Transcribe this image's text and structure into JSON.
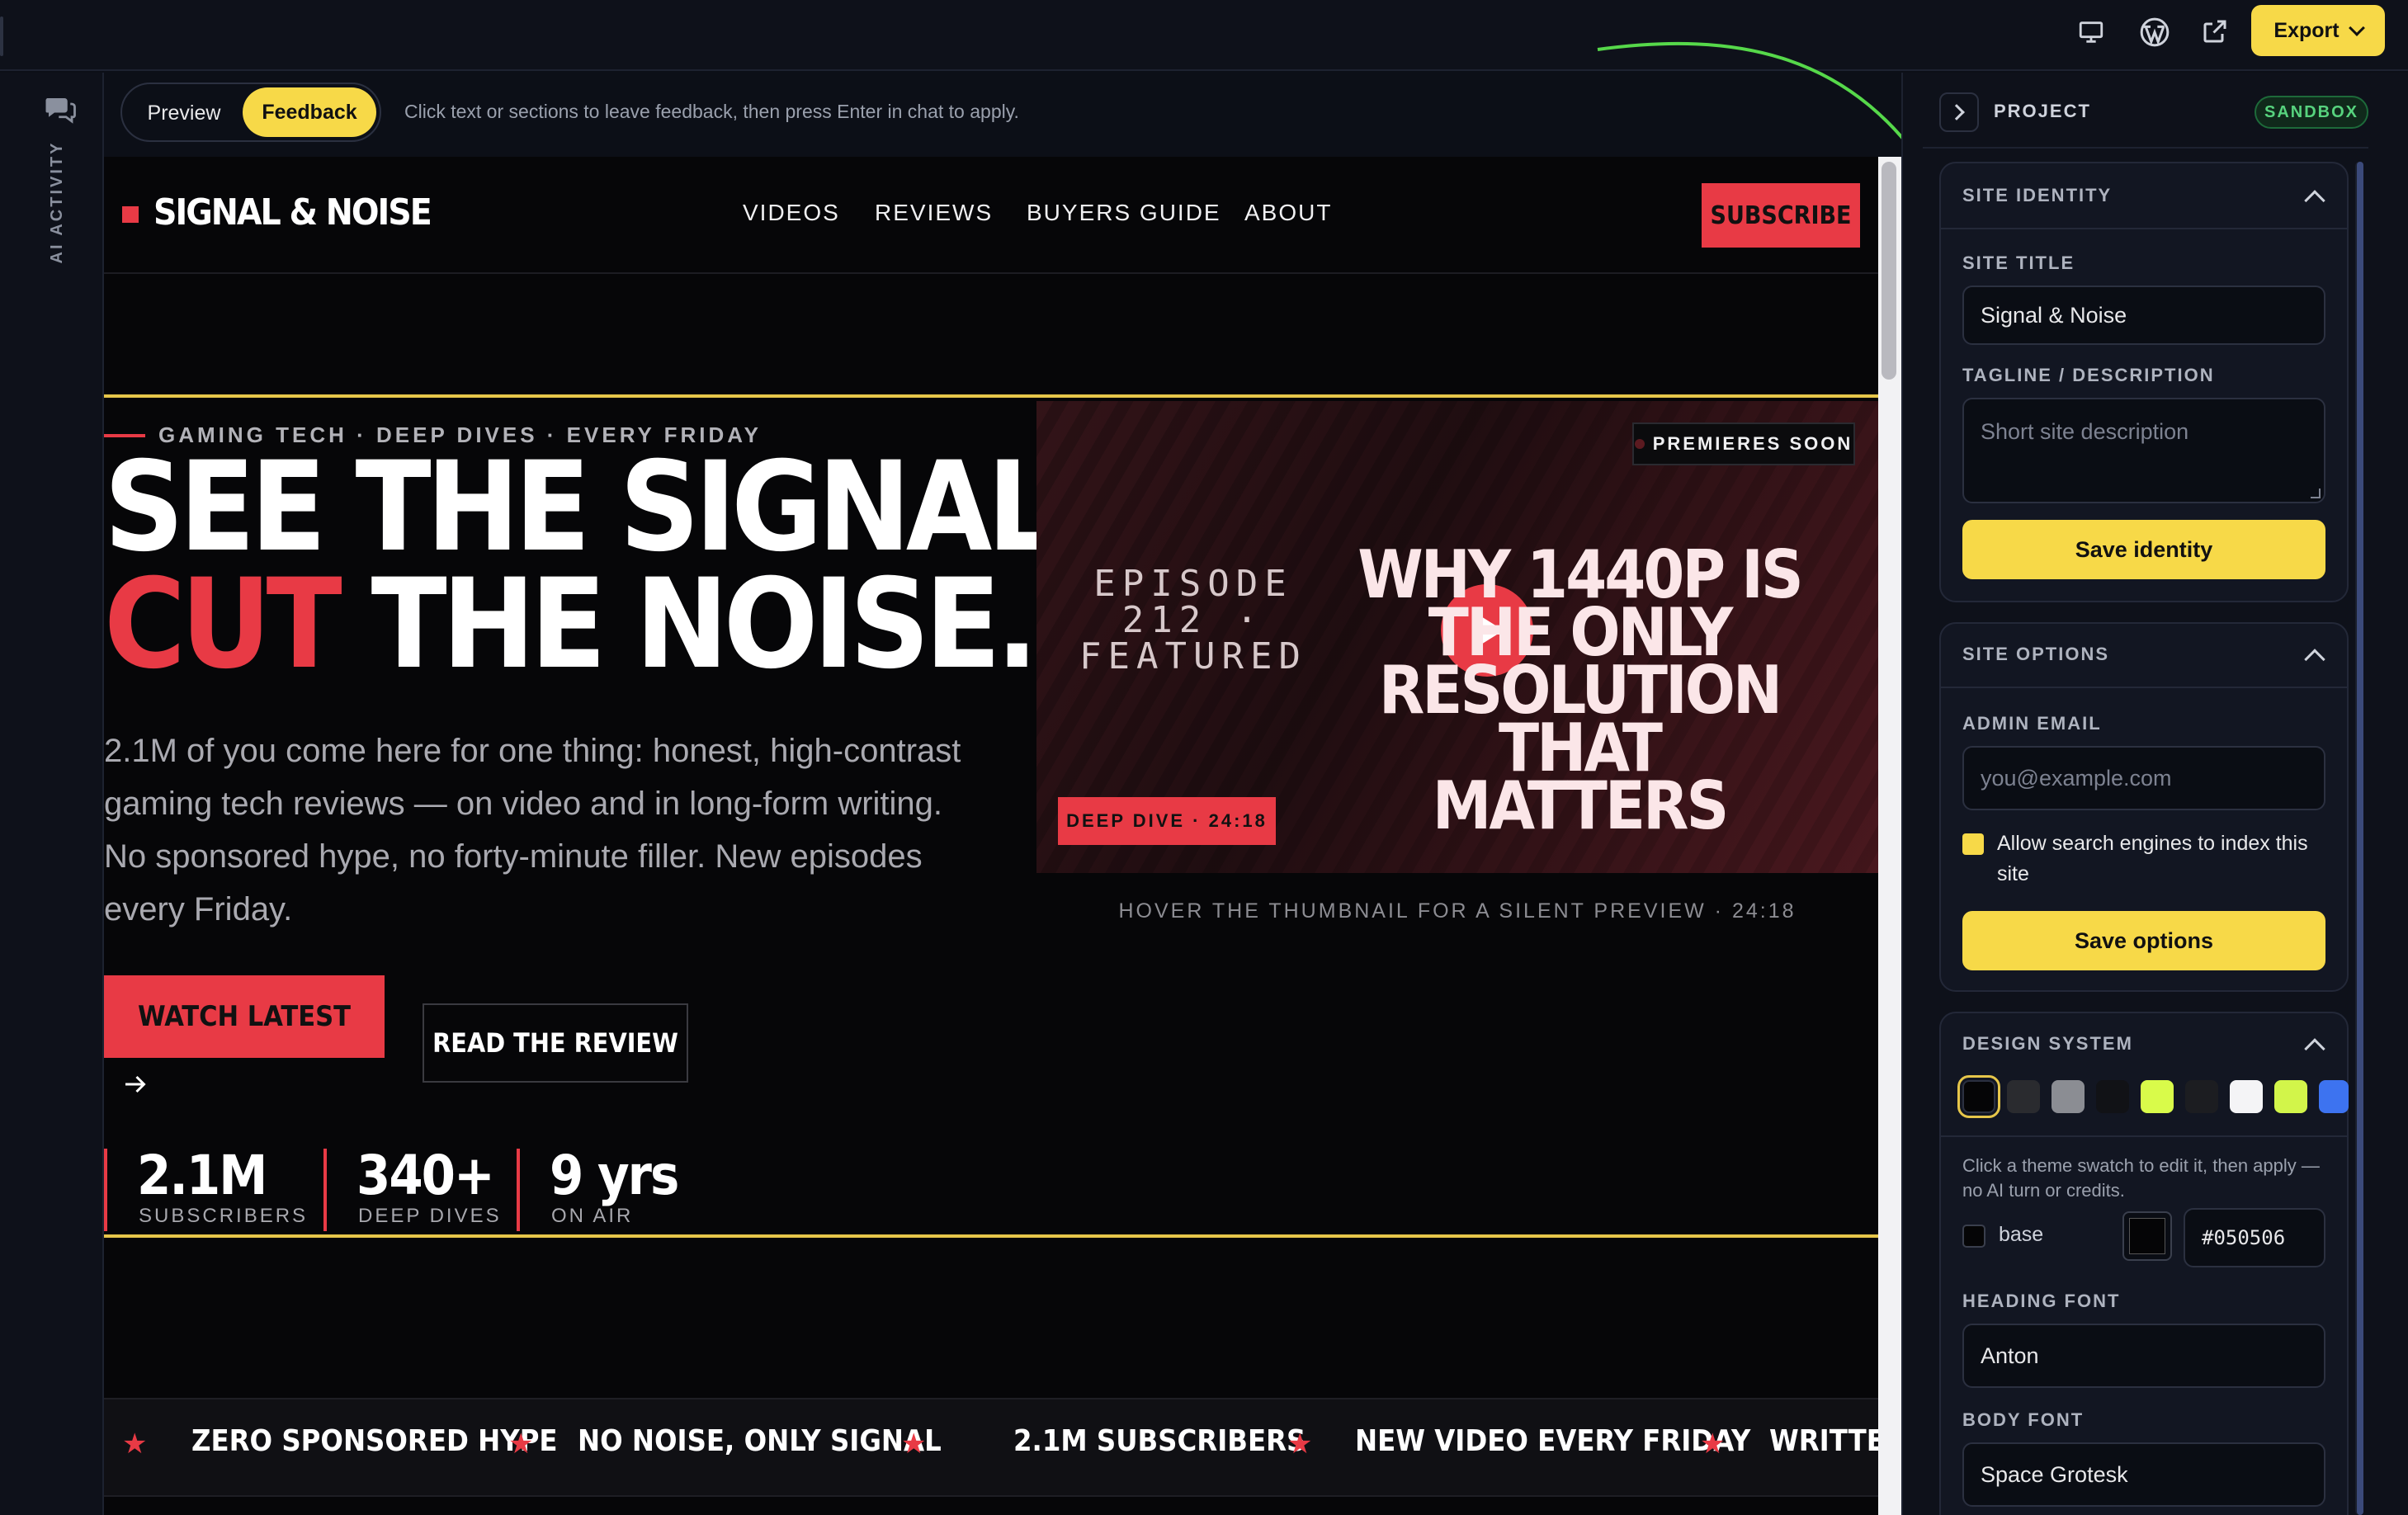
{
  "topbar": {
    "export_label": "Export"
  },
  "activity": {
    "label": "AI ACTIVITY"
  },
  "mode_toggle": {
    "preview": "Preview",
    "feedback": "Feedback",
    "hint": "Click text or sections to leave feedback, then press Enter in chat to apply."
  },
  "site": {
    "brand": "SIGNAL & NOISE",
    "nav": [
      "VIDEOS",
      "REVIEWS",
      "BUYERS GUIDE",
      "ABOUT"
    ],
    "subscribe": "SUBSCRIBE",
    "hero": {
      "eyebrow": "GAMING TECH · DEEP DIVES · EVERY FRIDAY",
      "line1": "SEE THE SIGNAL.",
      "line2_red": "CUT",
      "line2_rest": " THE NOISE.",
      "body": "2.1M of you come here for one thing: honest, high-contrast gaming tech reviews — on video and in long-form writing. No sponsored hype, no forty-minute filler. New episodes every Friday.",
      "cta_primary": "WATCH LATEST",
      "cta_secondary": "READ THE REVIEW"
    },
    "stats": [
      {
        "value": "2.1M",
        "label": "SUBSCRIBERS"
      },
      {
        "value": "340+",
        "label": "DEEP DIVES"
      },
      {
        "value": "9 yrs",
        "label": "ON AIR"
      }
    ],
    "thumbnail": {
      "badge": "PREMIERES SOON",
      "episode": "EPISODE 212 · FEATURED",
      "title": "WHY 1440P IS THE ONLY RESOLUTION THAT MATTERS",
      "tag": "DEEP DIVE · 24:18",
      "caption": "HOVER THE THUMBNAIL FOR A SILENT PREVIEW · 24:18"
    },
    "marquee": [
      "ZERO SPONSORED HYPE",
      "NO NOISE, ONLY SIGNAL",
      "2.1M SUBSCRIBERS",
      "NEW VIDEO EVERY FRIDAY",
      "WRITTEN"
    ]
  },
  "panel": {
    "title": "PROJECT",
    "badge": "SANDBOX",
    "identity": {
      "heading": "SITE IDENTITY",
      "title_label": "SITE TITLE",
      "title_value": "Signal & Noise",
      "tagline_label": "TAGLINE / DESCRIPTION",
      "tagline_placeholder": "Short site description",
      "save": "Save identity"
    },
    "options": {
      "heading": "SITE OPTIONS",
      "email_label": "ADMIN EMAIL",
      "email_placeholder": "you@example.com",
      "index_label": "Allow search engines to index this site",
      "save": "Save options"
    },
    "design": {
      "heading": "DESIGN SYSTEM",
      "swatches": [
        "#050506",
        "#2a2b2f",
        "#8b8d93",
        "#111216",
        "#d9fb4a",
        "#1c1d21",
        "#f4f4f6",
        "#d2f54a",
        "#3d73f0"
      ],
      "hint": "Click a theme swatch to edit it, then apply — no AI turn or credits.",
      "token_label": "base",
      "token_hex": "#050506",
      "heading_font_label": "HEADING FONT",
      "heading_font": "Anton",
      "body_font_label": "BODY FONT",
      "body_font": "Space Grotesk"
    }
  }
}
